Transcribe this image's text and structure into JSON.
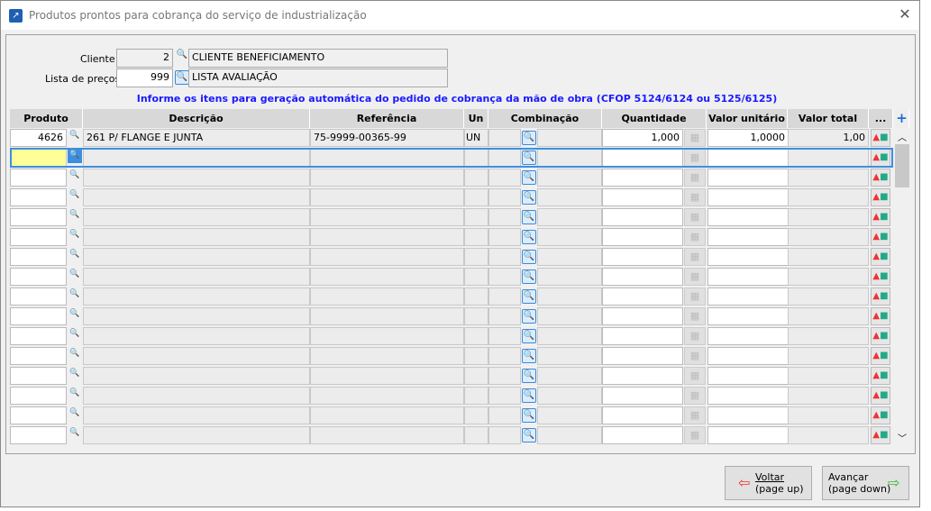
{
  "window": {
    "title": "Produtos prontos para cobrança do serviço de industrialização"
  },
  "header": {
    "cliente_label": "Cliente",
    "cliente_code": "2",
    "cliente_name": "CLIENTE BENEFICIAMENTO",
    "lista_label": "Lista de preços",
    "lista_code": "999",
    "lista_name": "LISTA AVALIAÇÃO",
    "info": "Informe os itens para geração automática do pedido de cobrança da mão de obra (CFOP 5124/6124 ou 5125/6125)"
  },
  "columns": {
    "produto": "Produto",
    "descricao": "Descrição",
    "referencia": "Referência",
    "un": "Un",
    "combinacao": "Combinação",
    "quantidade": "Quantidade",
    "valor_unitario": "Valor unitário",
    "valor_total": "Valor total",
    "more": "...",
    "add": "+"
  },
  "rows": [
    {
      "produto": "4626",
      "descricao": "261 P/ FLANGE E JUNTA",
      "referencia": "75-9999-00365-99",
      "un": "UN",
      "quantidade": "1,000",
      "valor_unitario": "1,0000",
      "valor_total": "1,00"
    },
    {},
    {},
    {},
    {},
    {},
    {},
    {},
    {},
    {},
    {},
    {},
    {},
    {},
    {},
    {}
  ],
  "buttons": {
    "voltar_line1": "Voltar",
    "voltar_line2": "(page up)",
    "avancar_line1": "Avançar",
    "avancar_line2": "(page down)"
  },
  "colors": {
    "info": "#1a1aff",
    "selection": "#3d8fe0",
    "active_cell": "#ffff99"
  }
}
